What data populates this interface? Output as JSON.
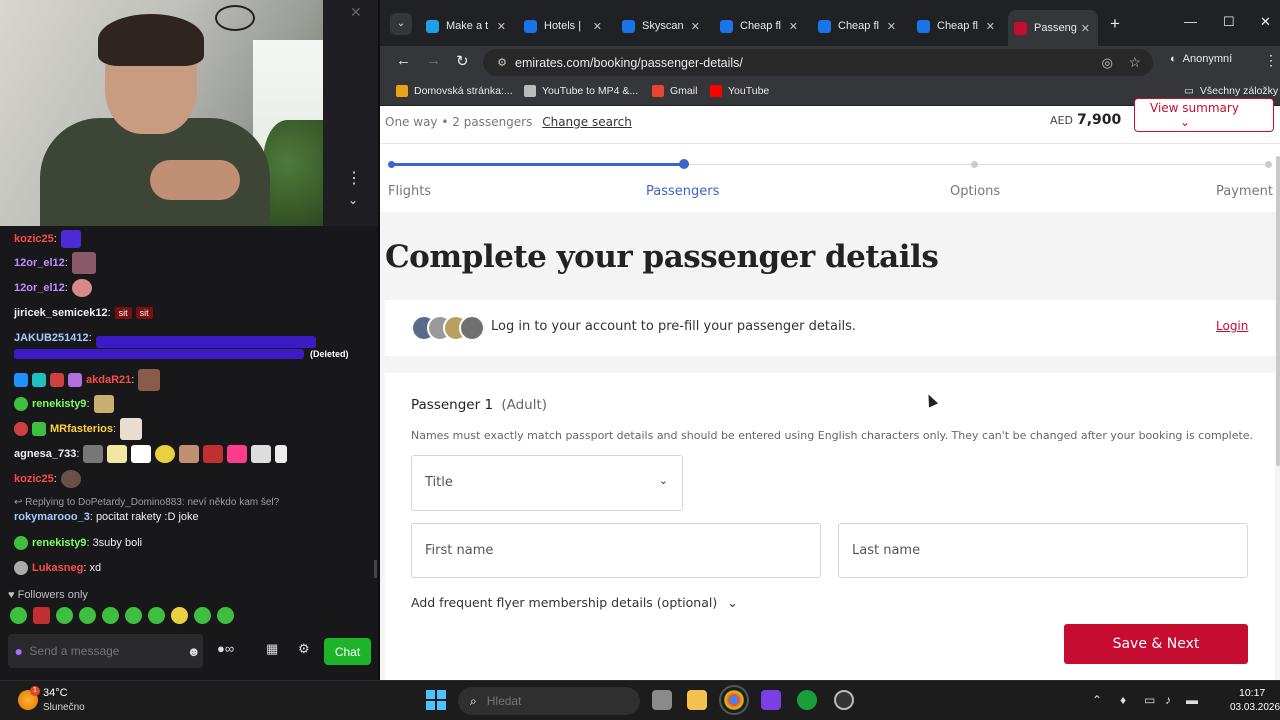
{
  "chat": {
    "lines": [
      {
        "user": "kozic25",
        "color": "#ff4a4a",
        "text": ""
      },
      {
        "user": "12or_el12",
        "color": "#c38bff",
        "text": ""
      },
      {
        "user": "12or_el12",
        "color": "#c38bff",
        "text": ""
      },
      {
        "user": "jiricek_semicek12",
        "color": "#efeff1",
        "text": "",
        "tags": [
          "sit",
          "sit"
        ]
      },
      {
        "user": "JAKUB251412",
        "color": "#a6c8ff",
        "text": ""
      },
      {
        "user": "akdaR21",
        "color": "#ff4a4a",
        "text": ""
      },
      {
        "user": "renekisty9",
        "color": "#7cff5e",
        "text": ""
      },
      {
        "user": "MRfasterios",
        "color": "#ffd23a",
        "text": ""
      },
      {
        "user": "agnesa_733",
        "color": "#efeff1",
        "text": ""
      },
      {
        "user": "kozic25",
        "color": "#ff4a4a",
        "text": ""
      },
      {
        "user": "rokymarooo_3",
        "color": "#a6c8ff",
        "text": "pocitat rakety :D joke"
      },
      {
        "user": "renekisty9",
        "color": "#7cff5e",
        "text": "3suby boli"
      },
      {
        "user": "Lukasneg",
        "color": "#ff4a4a",
        "text": "xd"
      }
    ],
    "deleted_label": "(Deleted)",
    "reply_text": "Replying to DoPetardy_Domino883: neví někdo kam šel?",
    "followers_only": "Followers only",
    "send_placeholder": "Send a message",
    "chat_button": "Chat"
  },
  "browser": {
    "tabs": [
      {
        "label": "Make a t",
        "fav_color": "#1fa0e6",
        "active": false
      },
      {
        "label": "Hotels |",
        "fav_color": "#1a73e8",
        "active": false
      },
      {
        "label": "Skyscan",
        "fav_color": "#1a73e8",
        "active": false
      },
      {
        "label": "Cheap fl",
        "fav_color": "#1a73e8",
        "active": false
      },
      {
        "label": "Cheap fl",
        "fav_color": "#1a73e8",
        "active": false
      },
      {
        "label": "Cheap fl",
        "fav_color": "#1a73e8",
        "active": false
      },
      {
        "label": "Passeng",
        "fav_color": "#c60c30",
        "active": true
      }
    ],
    "url": "emirates.com/booking/passenger-details/",
    "profile_label": "Anonymní",
    "bookmarks": [
      {
        "label": "Domovská stránka:...",
        "color": "#e8a317"
      },
      {
        "label": "YouTube to MP4 &...",
        "color": "#bbbbbb"
      },
      {
        "label": "Gmail",
        "color": "#ea4335"
      },
      {
        "label": "YouTube",
        "color": "#ff0000"
      }
    ],
    "all_bookmarks": "Všechny záložky"
  },
  "page": {
    "trip_type": "One way",
    "passengers": "2 passengers",
    "change_search": "Change search",
    "currency": "AED",
    "price": "7,900",
    "view_summary": "View summary",
    "steps": [
      {
        "label": "Flights",
        "state": "done"
      },
      {
        "label": "Passengers",
        "state": "current"
      },
      {
        "label": "Options",
        "state": "todo"
      },
      {
        "label": "Payment",
        "state": "todo"
      }
    ],
    "heading": "Complete your passenger details",
    "login_prompt": "Log in to your account to pre-fill your passenger details.",
    "login_link": "Login",
    "passenger_title": "Passenger 1",
    "passenger_type": "(Adult)",
    "name_note": "Names must exactly match passport details and should be entered using English characters only. They can't be changed after your booking is complete.",
    "title_placeholder": "Title",
    "first_name_placeholder": "First name",
    "last_name_placeholder": "Last name",
    "ffm_label": "Add frequent flyer membership details (optional)",
    "save_next": "Save & Next",
    "colors": {
      "accent": "#c60c30",
      "progress": "#3d63c7"
    }
  },
  "taskbar": {
    "temperature": "34°C",
    "condition": "Slunečno",
    "weather_badge": "1",
    "search_placeholder": "Hledat",
    "time": "10:17",
    "date": "03.03.2026"
  }
}
